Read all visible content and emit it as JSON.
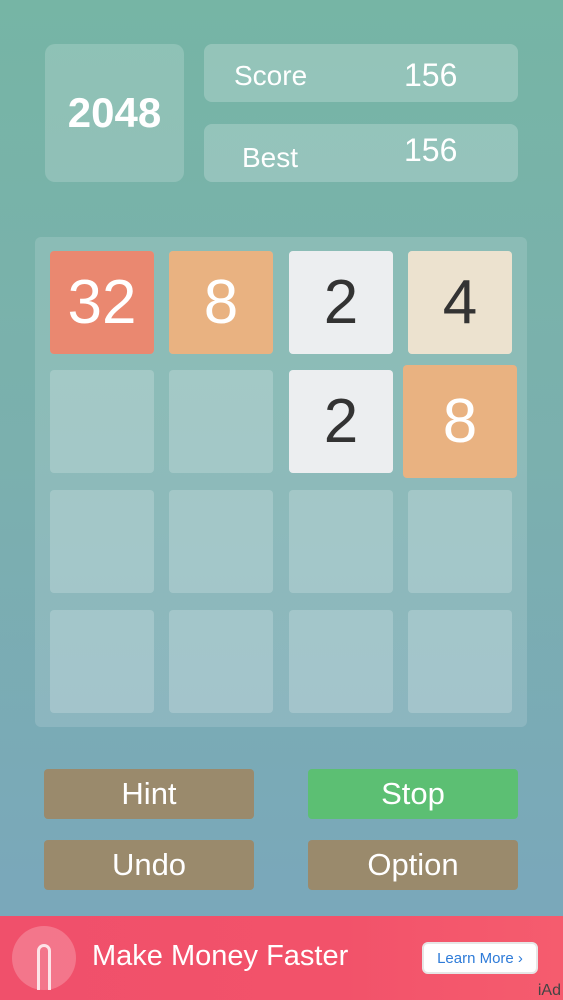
{
  "title": "2048",
  "score": {
    "label": "Score",
    "value": "156"
  },
  "best": {
    "label": "Best",
    "value": "156"
  },
  "board": {
    "rows": [
      [
        "32",
        "8",
        "2",
        "4"
      ],
      [
        "",
        "",
        "2",
        "8"
      ],
      [
        "",
        "",
        "",
        ""
      ],
      [
        "",
        "",
        "",
        ""
      ]
    ]
  },
  "tile_colors": {
    "2": {
      "bg": "#eceef0",
      "fg": "#333333"
    },
    "4": {
      "bg": "#ece2cf",
      "fg": "#333333"
    },
    "8": {
      "bg": "#e9b281",
      "fg": "#ffffff"
    },
    "32": {
      "bg": "#ea8870",
      "fg": "#ffffff"
    }
  },
  "buttons": {
    "hint": "Hint",
    "stop": "Stop",
    "undo": "Undo",
    "option": "Option"
  },
  "colors": {
    "button_brown": "#9a8a6c",
    "button_green": "#5cbf73",
    "ad_background": "#f0506b"
  },
  "ad": {
    "icon": "finger-tap-icon",
    "title": "Make Money Faster",
    "cta": "Learn More ›",
    "tag": "iAd"
  }
}
